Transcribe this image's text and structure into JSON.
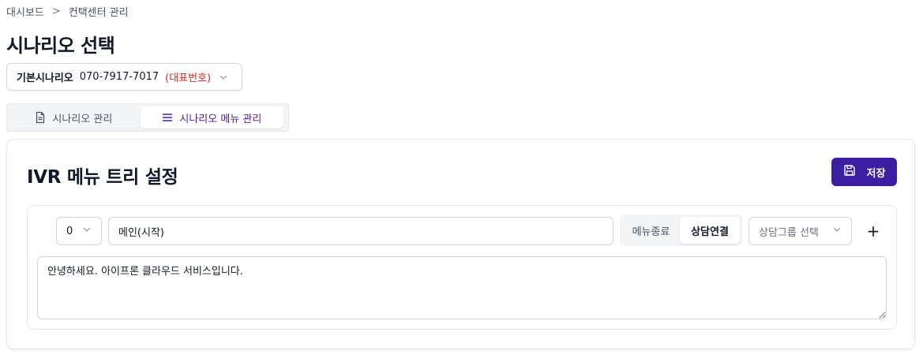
{
  "breadcrumb": {
    "items": [
      "대시보드",
      "컨택센터 관리"
    ],
    "separator": ">"
  },
  "page": {
    "title": "시나리오 선택"
  },
  "scenario_select": {
    "name": "기본시나리오",
    "phone": "070-7917-7017",
    "representative": "(대표번호)",
    "icon": "chevron-down-icon"
  },
  "tabs": [
    {
      "label": "시나리오 관리",
      "icon": "document-icon",
      "active": false
    },
    {
      "label": "시나리오 메뉴 관리",
      "icon": "list-icon",
      "active": true
    }
  ],
  "card": {
    "title": "IVR 메뉴 트리 설정",
    "save_label": "저장",
    "save_icon": "floppy-disk-icon"
  },
  "menu": {
    "number": "0",
    "name_value": "메인(시작)",
    "mode_options": [
      "메뉴종료",
      "상담연결"
    ],
    "mode_selected": "상담연결",
    "group_placeholder": "상담그룹 선택",
    "add_label": "+",
    "message": "안녕하세요. 아이프론 클라우드 서비스입니다."
  },
  "colors": {
    "accent": "#3b1fa3",
    "active_tab_text": "#4c1d95",
    "representative": "#dc2626"
  }
}
